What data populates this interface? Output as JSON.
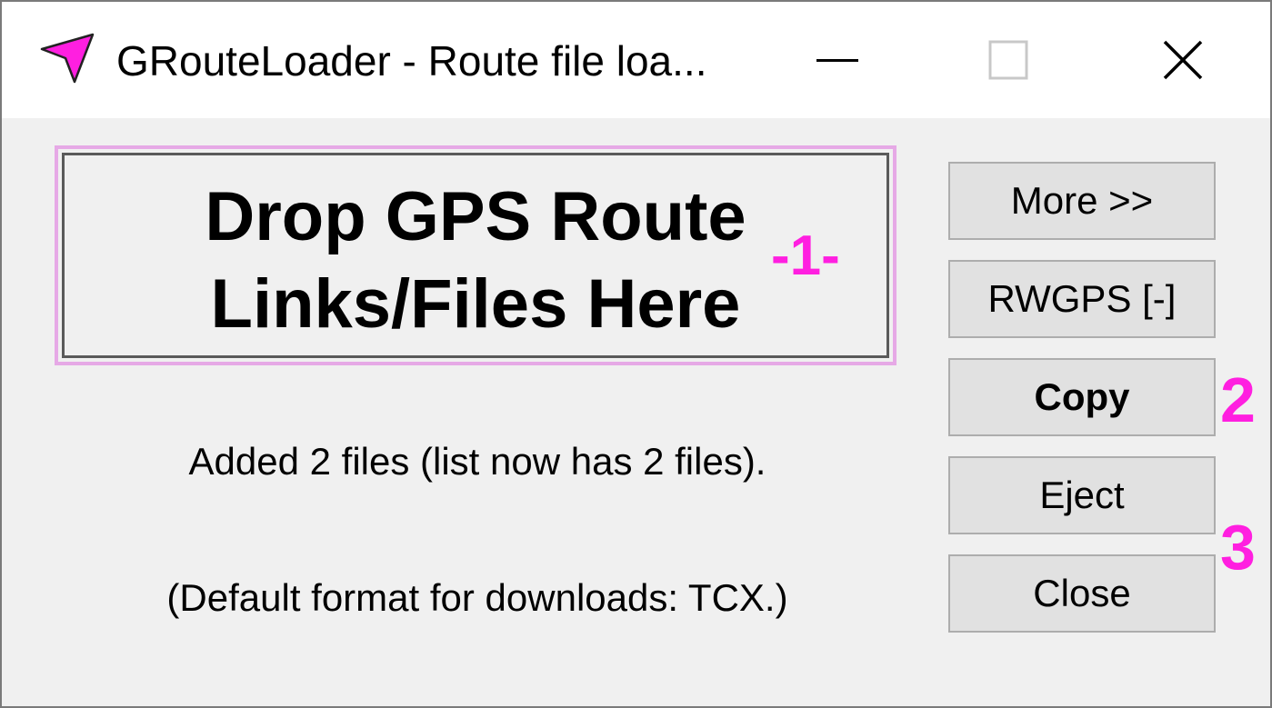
{
  "window": {
    "title": "GRouteLoader - Route file loa...",
    "icon": "pink-arrow-cursor-icon",
    "accent_color": "#ff1fe0"
  },
  "dropzone": {
    "line1": "Drop GPS Route",
    "line2": "Links/Files Here"
  },
  "markers": {
    "one": "-1-",
    "two": "2",
    "three": "3"
  },
  "status": {
    "added": "Added 2 files (list now has 2 files).",
    "default_format": "(Default format for downloads: TCX.)"
  },
  "buttons": {
    "more": "More >>",
    "rwgps": "RWGPS [-]",
    "copy": "Copy",
    "eject": "Eject",
    "close": "Close"
  }
}
